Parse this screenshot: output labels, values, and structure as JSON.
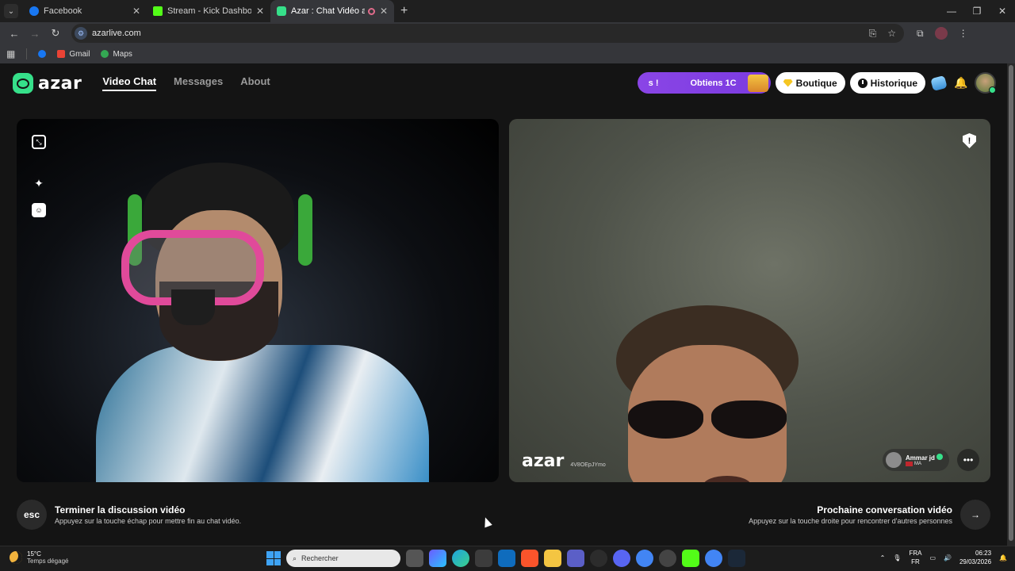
{
  "browser": {
    "tabs": [
      {
        "title": "Facebook",
        "color": "#1877f2",
        "active": false
      },
      {
        "title": "Stream - Kick Dashboard",
        "color": "#53fc18",
        "active": false
      },
      {
        "title": "Azar : Chat Vidéo avec de n",
        "color": "#36e08a",
        "active": true
      }
    ],
    "url": "azarlive.com",
    "bookmarks": [
      {
        "label": "Gmail",
        "color": "#ea4335"
      },
      {
        "label": "Maps",
        "color": "#34a853"
      }
    ]
  },
  "site": {
    "logo_text": "azar",
    "nav": [
      {
        "label": "Video Chat",
        "active": true
      },
      {
        "label": "Messages",
        "active": false
      },
      {
        "label": "About",
        "active": false
      }
    ],
    "promo": {
      "part1": "s !",
      "part2": "Obtiens 1C"
    },
    "shop_label": "Boutique",
    "history_label": "Historique",
    "accent": "#36e08a"
  },
  "remote": {
    "watermark": "azar",
    "session_id": "4V8OEpJYmo",
    "peer_name": "Ammar jd",
    "peer_country": "MA"
  },
  "actions": {
    "end_key": "esc",
    "end_title": "Terminer la discussion vidéo",
    "end_sub": "Appuyez sur la touche échap pour mettre fin au chat vidéo.",
    "next_title": "Prochaine conversation vidéo",
    "next_sub": "Appuyez sur la touche droite pour rencontrer d'autres personnes"
  },
  "taskbar": {
    "temp": "15°C",
    "weather": "Temps dégagé",
    "search_placeholder": "Rechercher",
    "lang1": "FRA",
    "lang2": "FR",
    "time": "06:23",
    "date": "29/03/2026"
  }
}
